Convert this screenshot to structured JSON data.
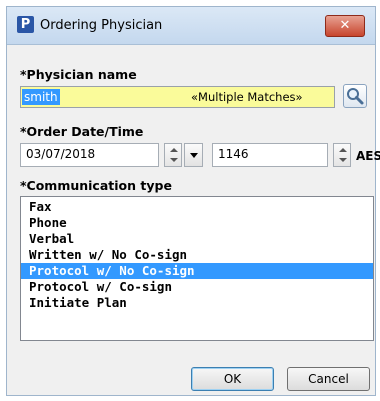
{
  "window": {
    "title": "Ordering Physician",
    "app_icon_letter": "P",
    "close_glyph": "✕"
  },
  "physician": {
    "label": "*Physician name",
    "value": "smith",
    "message": "«Multiple Matches»"
  },
  "order": {
    "label": "*Order Date/Time",
    "date": "03/07/2018",
    "time": "1146",
    "timezone": "AEST"
  },
  "communication": {
    "label": "*Communication type",
    "items": [
      "Fax",
      "Phone",
      "Verbal",
      "Written w/ No Co-sign",
      "Protocol w/ No Co-sign",
      "Protocol w/ Co-sign",
      "Initiate Plan"
    ],
    "selected_index": 4
  },
  "buttons": {
    "ok": "OK",
    "cancel": "Cancel"
  },
  "colors": {
    "highlight": "#3399ff",
    "field_yellow": "#fafb9a",
    "close_red": "#c7452d"
  }
}
